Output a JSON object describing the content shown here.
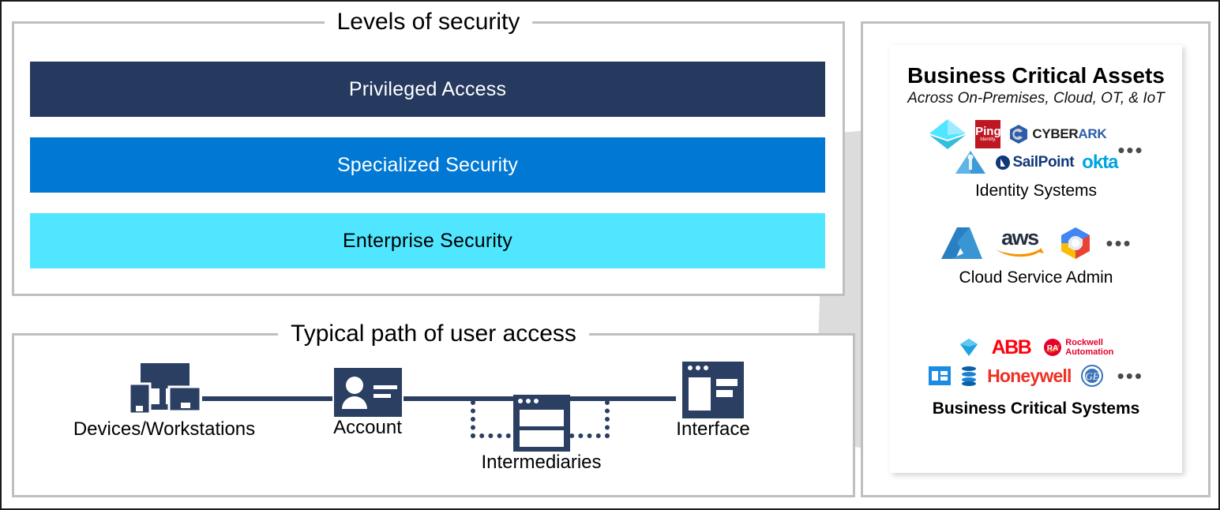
{
  "levels": {
    "title": "Levels of security",
    "bars": [
      {
        "label": "Privileged Access",
        "color": "#26395e",
        "text_color": "#ffffff"
      },
      {
        "label": "Specialized Security",
        "color": "#0078d4",
        "text_color": "#ffffff"
      },
      {
        "label": "Enterprise Security",
        "color": "#50e6ff",
        "text_color": "#000000"
      }
    ]
  },
  "path": {
    "title": "Typical path of user access",
    "nodes": [
      {
        "label": "Devices/Workstations",
        "icon": "monitor-tower-icon"
      },
      {
        "label": "Account",
        "icon": "id-card-icon"
      },
      {
        "label": "Intermediaries",
        "icon": "browser-window-icon"
      },
      {
        "label": "Interface",
        "icon": "app-window-icon"
      }
    ],
    "connector_color": "#2b3f63"
  },
  "assets": {
    "title": "Business Critical Assets",
    "subtitle": "Across On-Premises, Cloud, OT, & IoT",
    "ellipsis": "•••",
    "categories": [
      {
        "label": "Identity Systems",
        "rows": [
          [
            "azure-ad-pyramid-icon",
            "ping-identity-logo",
            "cyberark-logo"
          ],
          [
            "active-directory-pyramid-icon",
            "sailpoint-logo",
            "okta-logo"
          ]
        ],
        "logos": {
          "cyberark": {
            "part1": "CYBER",
            "part2": "ARK"
          },
          "sailpoint": "SailPoint",
          "okta": "okta",
          "ping": {
            "main": "Ping",
            "sub": "Identity."
          }
        }
      },
      {
        "label": "Cloud Service Admin",
        "rows": [
          [
            "azure-logo",
            "aws-logo",
            "google-cloud-logo"
          ]
        ],
        "logos": {
          "aws": "aws"
        }
      },
      {
        "label": "Business Critical Systems",
        "rows": [
          [
            "sap-diamond-icon",
            "abb-logo",
            "rockwell-automation-logo"
          ],
          [
            "erp-window-icon",
            "database-stack-icon",
            "honeywell-logo",
            "ge-logo"
          ]
        ],
        "logos": {
          "abb": "ABB",
          "rockwell": {
            "line1": "Rockwell",
            "line2": "Automation"
          },
          "honeywell": "Honeywell",
          "ge": "GE"
        }
      }
    ]
  },
  "colors": {
    "frame": "#1a1a1a",
    "group_border": "#bfbfbf",
    "callout_fill": "#dcdcdc",
    "navy": "#26395e",
    "blue": "#0078d4",
    "cyan": "#50e6ff",
    "icon_navy": "#2b3f63"
  }
}
